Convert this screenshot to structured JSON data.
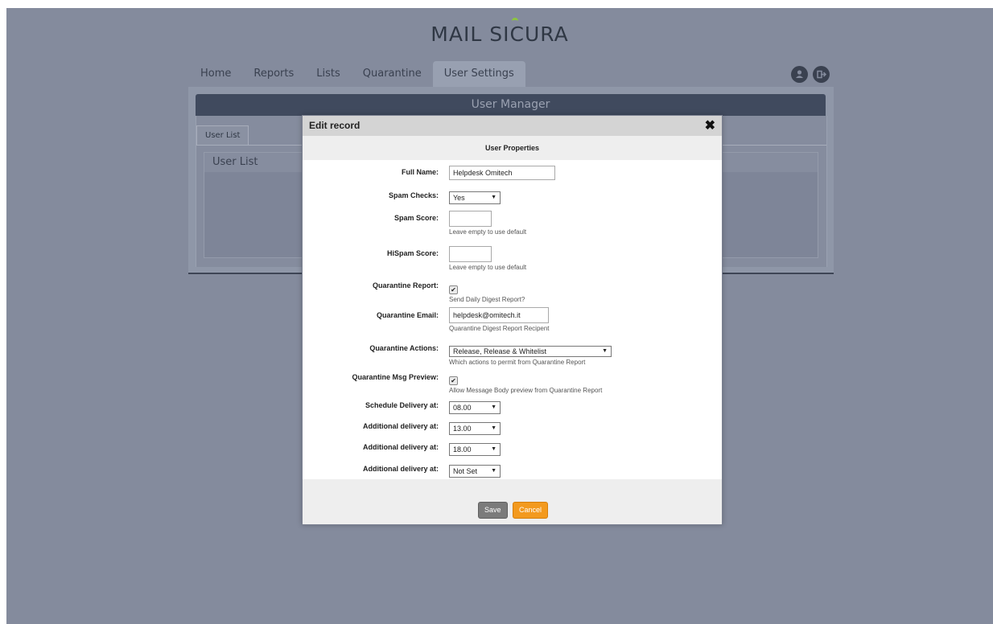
{
  "app": {
    "logo_main": "MAIL SI",
    "logo_accent": "C",
    "logo_end": "URA"
  },
  "nav": {
    "tabs": [
      {
        "label": "Home"
      },
      {
        "label": "Reports"
      },
      {
        "label": "Lists"
      },
      {
        "label": "Quarantine"
      },
      {
        "label": "User Settings",
        "active": true
      }
    ],
    "icons": [
      "user-icon",
      "logout-icon"
    ]
  },
  "content": {
    "header": "User Manager",
    "subtab": "User List",
    "list_title": "User List"
  },
  "modal": {
    "title": "Edit record",
    "section_title": "User Properties",
    "fields": {
      "full_name": {
        "label": "Full Name:",
        "value": "Helpdesk Omitech"
      },
      "spam_checks": {
        "label": "Spam Checks:",
        "value": "Yes"
      },
      "spam_score": {
        "label": "Spam Score:",
        "value": "",
        "hint": "Leave empty to use default"
      },
      "hispam_score": {
        "label": "HiSpam Score:",
        "value": "",
        "hint": "Leave empty to use default"
      },
      "quarantine_report": {
        "label": "Quarantine Report:",
        "checked": true,
        "hint": "Send Daily Digest Report?"
      },
      "quarantine_email": {
        "label": "Quarantine Email:",
        "value": "helpdesk@omitech.it",
        "hint": "Quarantine Digest Report Recipent"
      },
      "quarantine_actions": {
        "label": "Quarantine Actions:",
        "value": "Release, Release & Whitelist",
        "hint": "Which actions to permit from Quarantine Report"
      },
      "quarantine_preview": {
        "label": "Quarantine Msg Preview:",
        "checked": true,
        "hint": "Allow Message Body preview from Quarantine Report"
      },
      "schedule_delivery": {
        "label": "Schedule Delivery at:",
        "value": "08.00"
      },
      "additional_delivery_1": {
        "label": "Additional delivery at:",
        "value": "13.00"
      },
      "additional_delivery_2": {
        "label": "Additional delivery at:",
        "value": "18.00"
      },
      "additional_delivery_3": {
        "label": "Additional delivery at:",
        "value": "Not Set"
      }
    },
    "buttons": {
      "save": "Save",
      "cancel": "Cancel"
    }
  },
  "colors": {
    "background": "#848b9d",
    "header_bar": "#404a5e",
    "cancel_button": "#f39a1f",
    "save_button": "#7b7b7b",
    "logo_accent": "#8dc63f"
  }
}
